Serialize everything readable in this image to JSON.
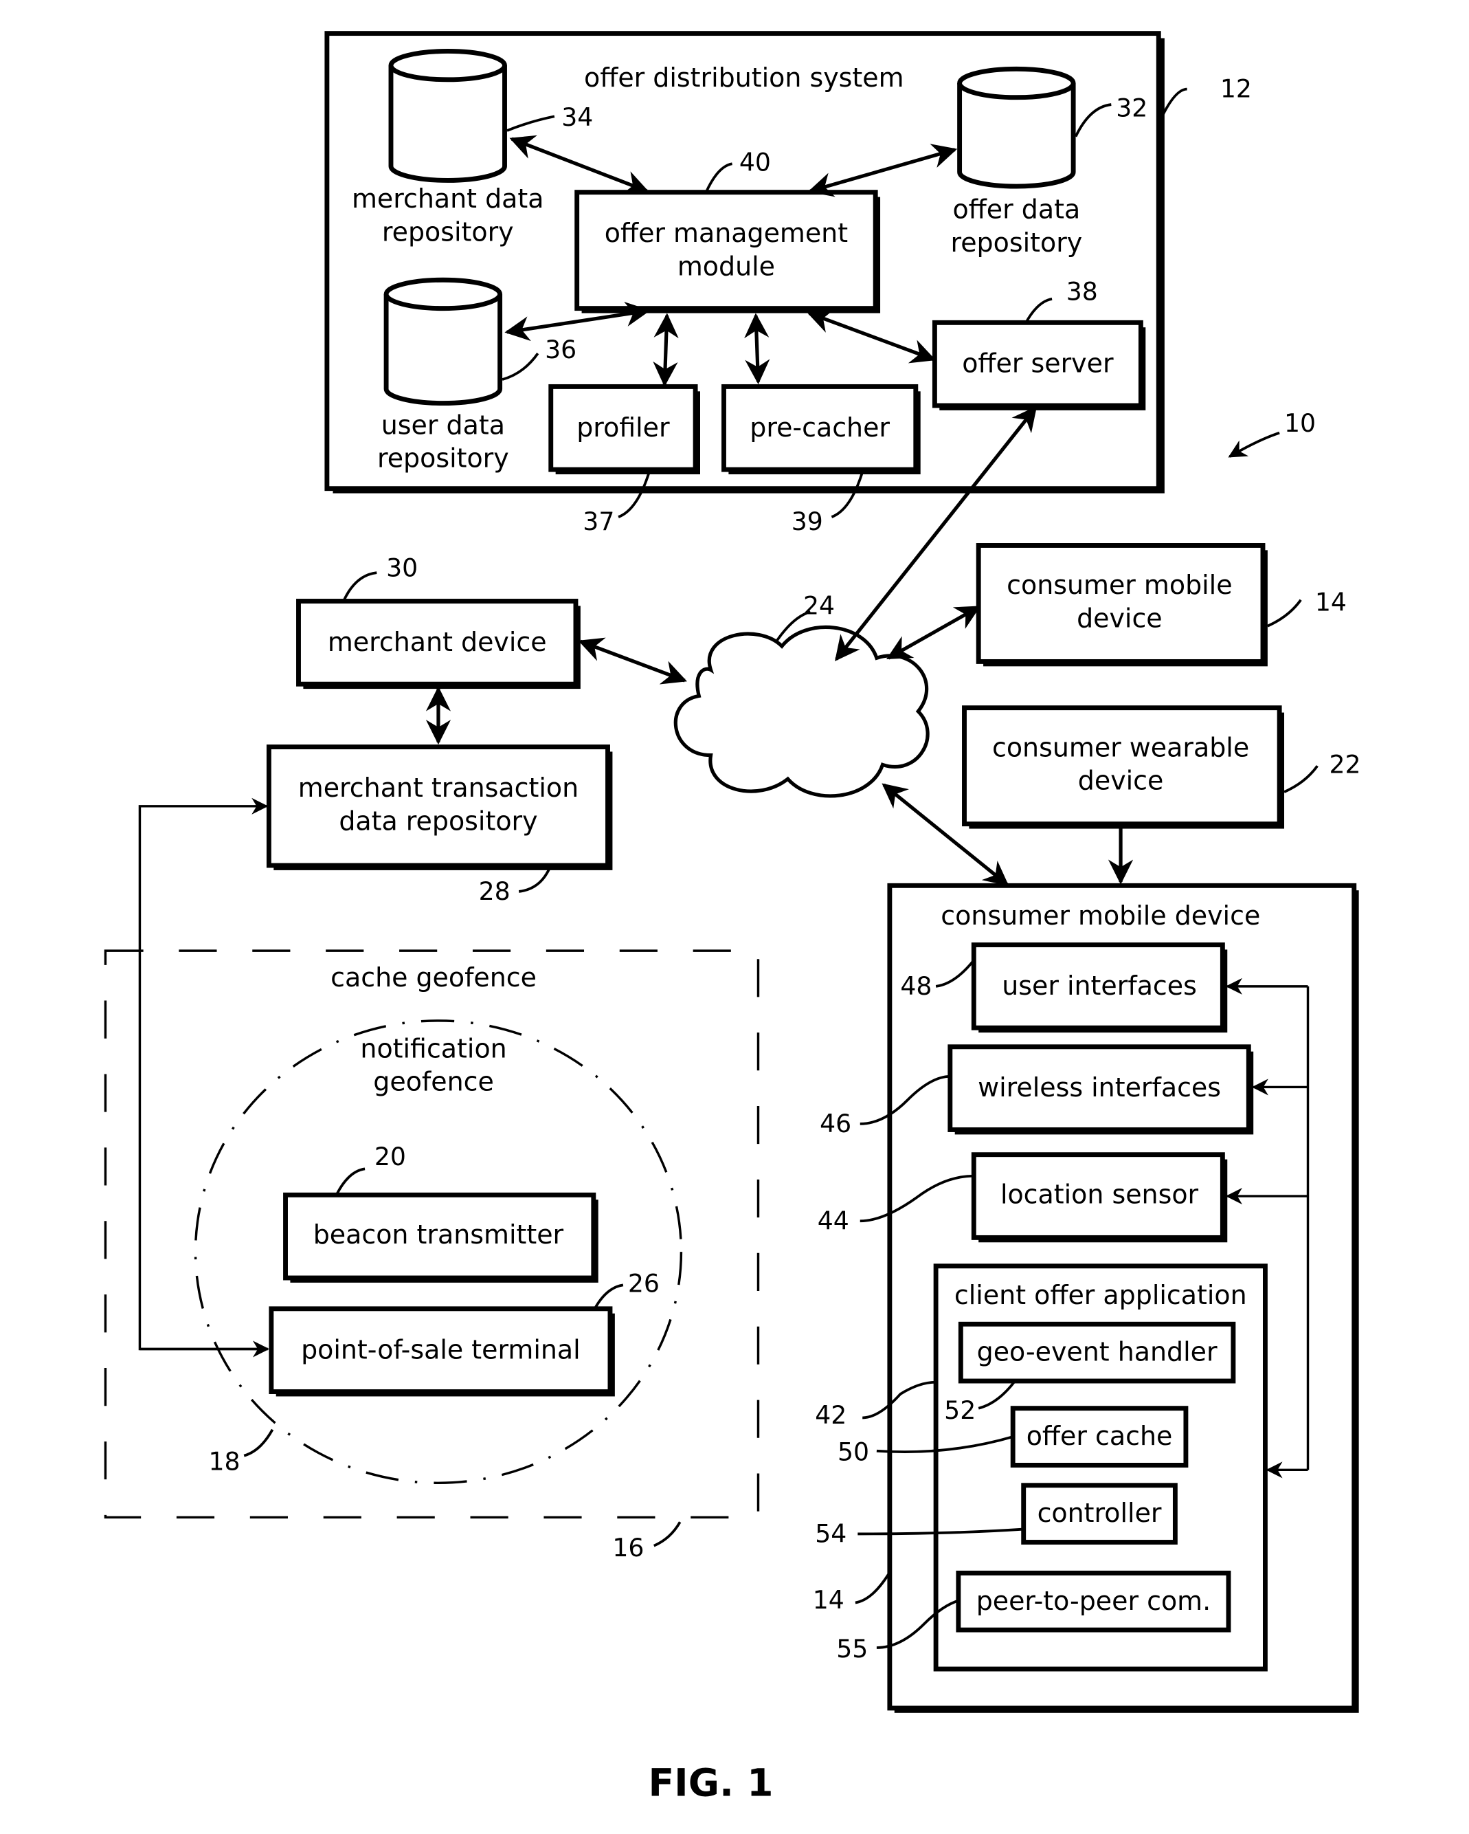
{
  "figure": {
    "caption": "FIG. 1",
    "system_ref": "10"
  },
  "offer_distribution_system": {
    "title": "offer distribution system",
    "ref": "12",
    "merchant_data_repository": {
      "line1": "merchant data",
      "line2": "repository",
      "ref": "34"
    },
    "offer_data_repository": {
      "line1": "offer data",
      "line2": "repository",
      "ref": "32"
    },
    "user_data_repository": {
      "line1": "user data",
      "line2": "repository",
      "ref": "36"
    },
    "offer_management_module": {
      "line1": "offer management",
      "line2": "module",
      "ref": "40"
    },
    "offer_server": {
      "label": "offer server",
      "ref": "38"
    },
    "profiler": {
      "label": "profiler",
      "ref": "37"
    },
    "pre_cacher": {
      "label": "pre-cacher",
      "ref": "39"
    }
  },
  "network": {
    "ref": "24"
  },
  "merchant_device": {
    "label": "merchant device",
    "ref": "30"
  },
  "merchant_transaction_repository": {
    "line1": "merchant transaction",
    "line2": "data repository",
    "ref": "28"
  },
  "consumer_mobile_device_top": {
    "line1": "consumer mobile",
    "line2": "device",
    "ref": "14"
  },
  "consumer_wearable_device": {
    "line1": "consumer wearable",
    "line2": "device",
    "ref": "22"
  },
  "cache_geofence": {
    "label": "cache geofence",
    "ref": "16"
  },
  "notification_geofence": {
    "line1": "notification",
    "line2": "geofence",
    "ref": "18"
  },
  "beacon_transmitter": {
    "label": "beacon transmitter",
    "ref": "20"
  },
  "point_of_sale_terminal": {
    "label": "point-of-sale terminal",
    "ref": "26"
  },
  "consumer_mobile_device": {
    "title": "consumer mobile device",
    "ref": "14",
    "user_interfaces": {
      "label": "user interfaces",
      "ref": "48"
    },
    "wireless_interfaces": {
      "label": "wireless interfaces",
      "ref": "46"
    },
    "location_sensor": {
      "label": "location sensor",
      "ref": "44"
    },
    "client_offer_application": {
      "title": "client offer application",
      "ref": "42",
      "geo_event_handler": {
        "label": "geo-event handler",
        "ref": "52"
      },
      "offer_cache": {
        "label": "offer cache",
        "ref": "50"
      },
      "controller": {
        "label": "controller",
        "ref": "54"
      },
      "peer_to_peer": {
        "label": "peer-to-peer com.",
        "ref": "55"
      }
    }
  }
}
